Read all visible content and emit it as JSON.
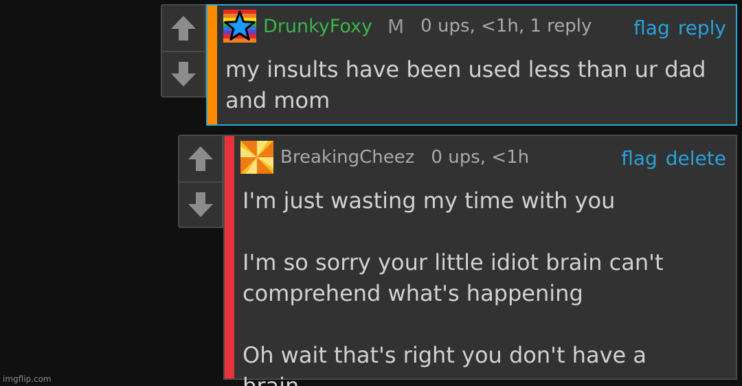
{
  "comments": [
    {
      "username": "DrunkyFoxy",
      "badge": "M",
      "meta": "0 ups, <1h, 1 reply",
      "actions": [
        "flag",
        "reply"
      ],
      "avatar_icon": "rainbow-star-icon",
      "stripe_color": "#ff8c00",
      "username_color": "#3ab54a",
      "highlighted": true,
      "paragraphs": [
        "my insults have been used less than ur dad and mom"
      ]
    },
    {
      "username": "BreakingCheez",
      "meta": "0 ups, <1h",
      "actions": [
        "flag",
        "delete"
      ],
      "avatar_icon": "pinwheel-icon",
      "stripe_color": "#e8333a",
      "paragraphs": [
        "I'm just wasting my time with you",
        "I'm so sorry your little idiot brain can't comprehend what's happening",
        "Oh wait that's right you don't have a brain"
      ]
    }
  ],
  "vote_icons": [
    "upvote-arrow-icon",
    "downvote-arrow-icon"
  ],
  "accent_colors": {
    "link": "#27a3dc",
    "highlight_border": "#2aa6d6",
    "background": "#101010",
    "panel": "#323232"
  },
  "watermark": "imgflip.com"
}
